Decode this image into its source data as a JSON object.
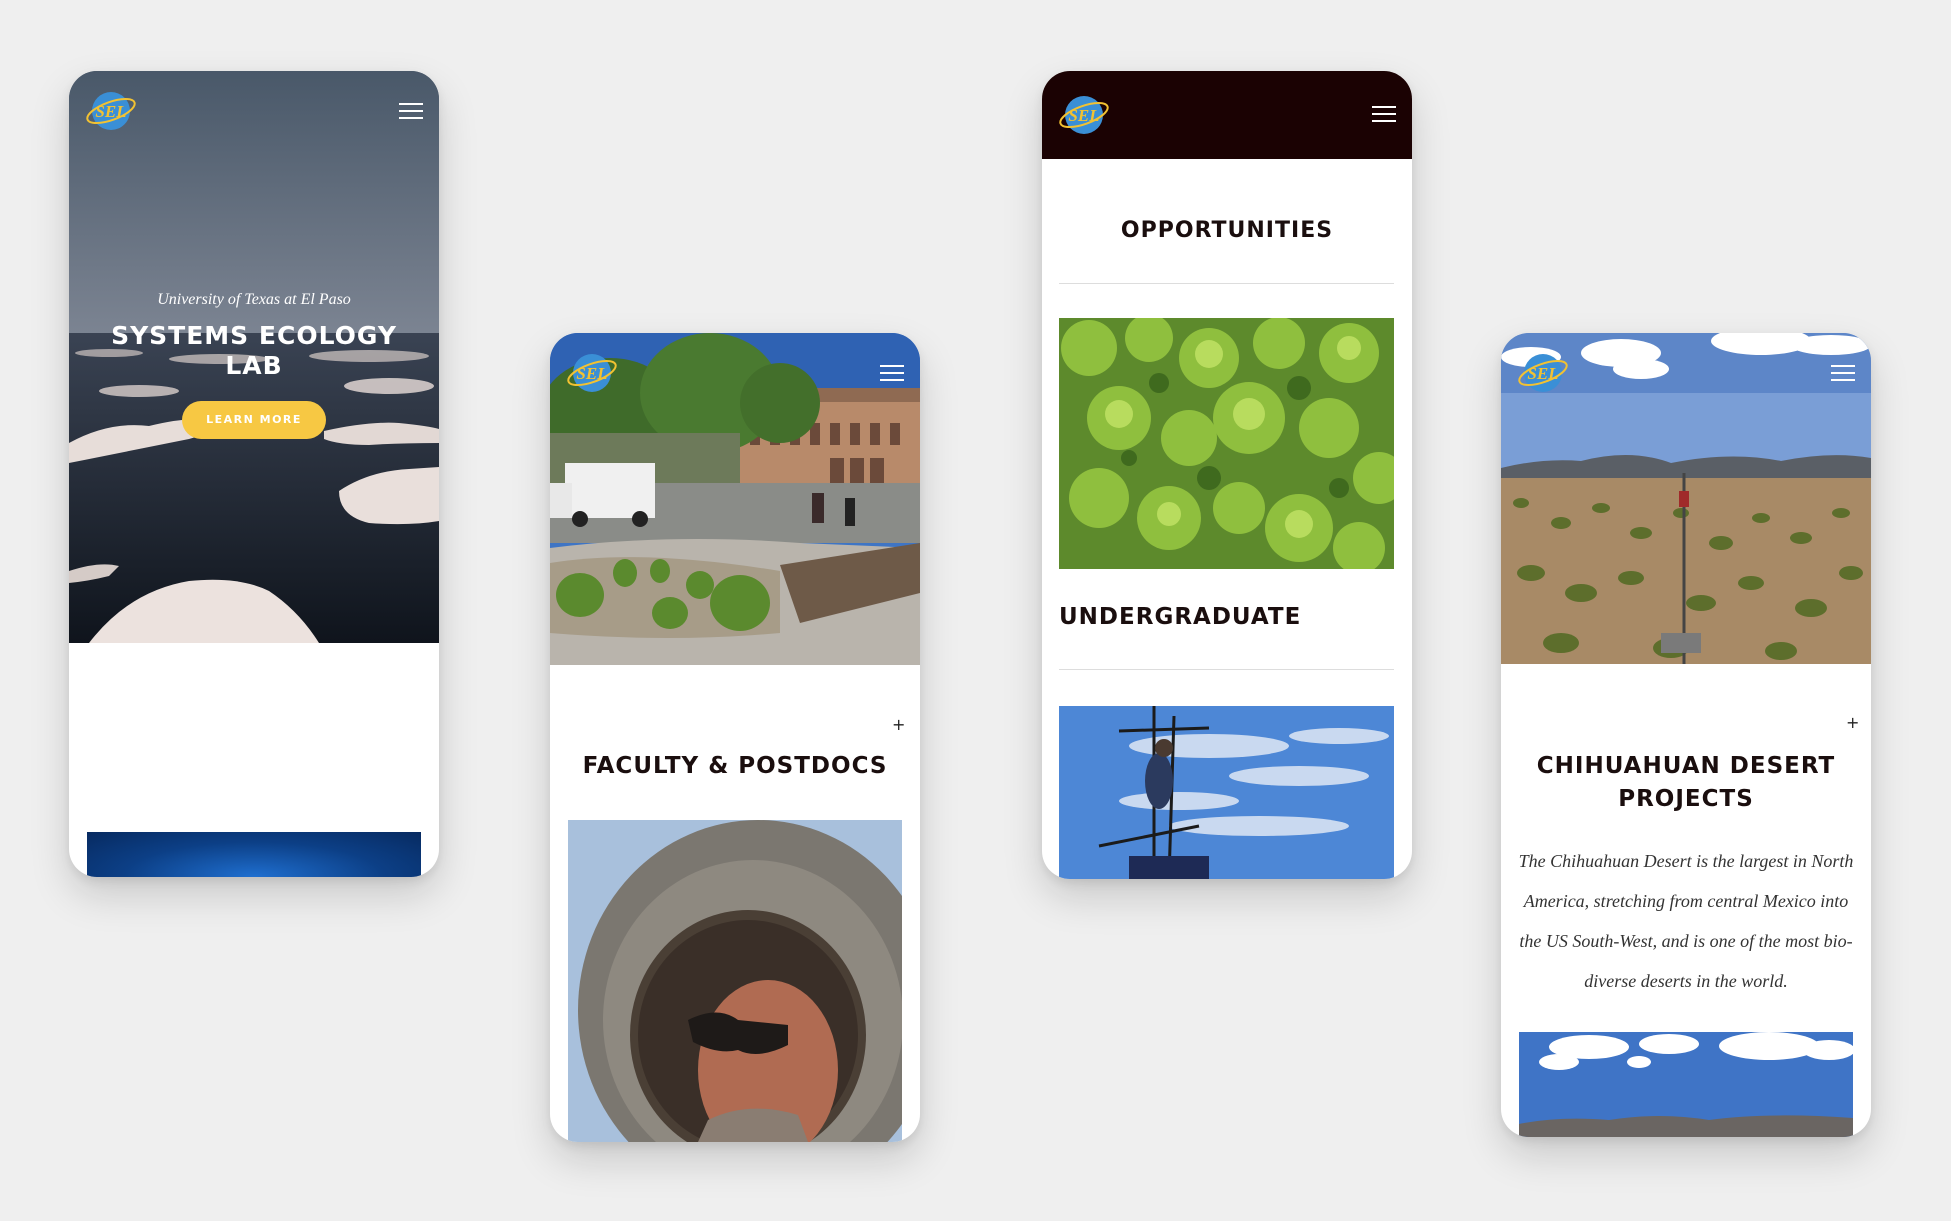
{
  "screens": [
    {
      "hero_tagline": "University of Texas at El Paso",
      "hero_title": "SYSTEMS ECOLOGY LAB",
      "cta_label": "LEARN MORE"
    },
    {
      "expand_symbol": "+",
      "section_title": "FACULTY & POSTDOCS"
    },
    {
      "section_title": "OPPORTUNITIES",
      "category_title": "UNDERGRADUATE"
    },
    {
      "expand_symbol": "+",
      "section_title": "CHIHUAHUAN DESERT PROJECTS",
      "description": "The Chihuahuan Desert is the largest in North America, stretching from central Mexico into the US South-West, and is one of the most bio-diverse deserts in the world."
    }
  ],
  "logo": {
    "text": "SEL",
    "colors": {
      "globe": "#3a8fd6",
      "ring": "#f2c232"
    }
  },
  "icons": [
    "logo",
    "hamburger-menu-icon",
    "plus-icon"
  ],
  "colors": {
    "page_background": "#efefef",
    "accent_yellow": "#f7c843",
    "dark_header": "#1b0203",
    "heading_text": "#1a0e0e"
  }
}
